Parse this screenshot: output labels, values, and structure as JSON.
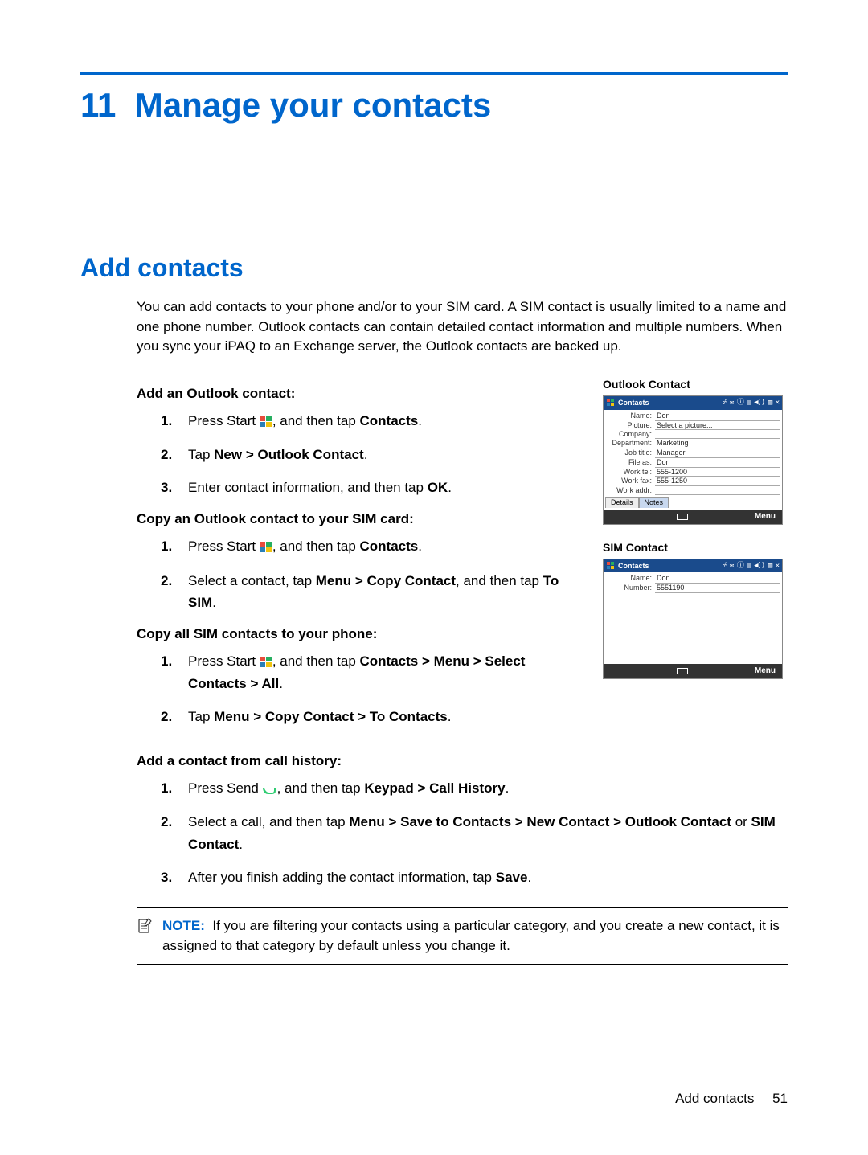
{
  "chapter": {
    "number": "11",
    "title": "Manage your contacts"
  },
  "section": {
    "title": "Add contacts",
    "intro": "You can add contacts to your phone and/or to your SIM card. A SIM contact is usually limited to a name and one phone number. Outlook contacts can contain detailed contact information and multiple numbers. When you sync your iPAQ to an Exchange server, the Outlook contacts are backed up."
  },
  "tasks": {
    "addOutlook": {
      "heading_prefix": "Add an Outlook contact",
      "colon": ":",
      "step1": {
        "num": "1.",
        "a": "Press Start ",
        "b": ", and then tap ",
        "c": "Contacts",
        "d": "."
      },
      "step2": {
        "num": "2.",
        "a": "Tap ",
        "b": "New > Outlook Contact",
        "c": "."
      },
      "step3": {
        "num": "3.",
        "a": "Enter contact information, and then tap ",
        "b": "OK",
        "c": "."
      }
    },
    "copyToSim": {
      "heading_prefix": "Copy an Outlook contact to your SIM card",
      "colon": ":",
      "step1": {
        "num": "1.",
        "a": "Press Start ",
        "b": ", and then tap ",
        "c": "Contacts",
        "d": "."
      },
      "step2": {
        "num": "2.",
        "a": "Select a contact, tap ",
        "b": "Menu > Copy Contact",
        "c": ", and then tap ",
        "d": "To SIM",
        "e": "."
      }
    },
    "copyAllSim": {
      "heading_prefix": "Copy all SIM contacts to your phone",
      "colon": ":",
      "step1": {
        "num": "1.",
        "a": "Press Start ",
        "b": ", and then tap ",
        "c": "Contacts > Menu > Select Contacts > All",
        "d": "."
      },
      "step2": {
        "num": "2.",
        "a": "Tap ",
        "b": "Menu > Copy Contact > To Contacts",
        "c": "."
      }
    },
    "addFromHistory": {
      "heading_prefix": "Add a contact from call history",
      "colon": ":",
      "step1": {
        "num": "1.",
        "a": "Press Send ",
        "b": ", and then tap ",
        "c": "Keypad > Call History",
        "d": "."
      },
      "step2": {
        "num": "2.",
        "a": "Select a call, and then tap ",
        "b": "Menu > Save to Contacts > New Contact > Outlook Contact",
        "c": " or ",
        "d": "SIM Contact",
        "e": "."
      },
      "step3": {
        "num": "3.",
        "a": "After you finish adding the contact information, tap ",
        "b": "Save",
        "c": "."
      }
    }
  },
  "screenshots": {
    "outlook": {
      "label": "Outlook Contact",
      "title": "Contacts",
      "fields": [
        {
          "label": "Name:",
          "value": "Don"
        },
        {
          "label": "Picture:",
          "value": "Select a picture..."
        },
        {
          "label": "Company:",
          "value": ""
        },
        {
          "label": "Department:",
          "value": "Marketing"
        },
        {
          "label": "Job title:",
          "value": "Manager"
        },
        {
          "label": "File as:",
          "value": "Don"
        },
        {
          "label": "Work tel:",
          "value": "555-1200"
        },
        {
          "label": "Work fax:",
          "value": "555-1250"
        },
        {
          "label": "Work addr:",
          "value": ""
        }
      ],
      "tabs": [
        "Details",
        "Notes"
      ],
      "menu": "Menu"
    },
    "sim": {
      "label": "SIM Contact",
      "title": "Contacts",
      "fields": [
        {
          "label": "Name:",
          "value": "Don"
        },
        {
          "label": "Number:",
          "value": "5551190"
        }
      ],
      "menu": "Menu"
    }
  },
  "note": {
    "label": "NOTE:",
    "text": "If you are filtering your contacts using a particular category, and you create a new contact, it is assigned to that category by default unless you change it."
  },
  "footer": {
    "section_name": "Add contacts",
    "page_number": "51"
  }
}
